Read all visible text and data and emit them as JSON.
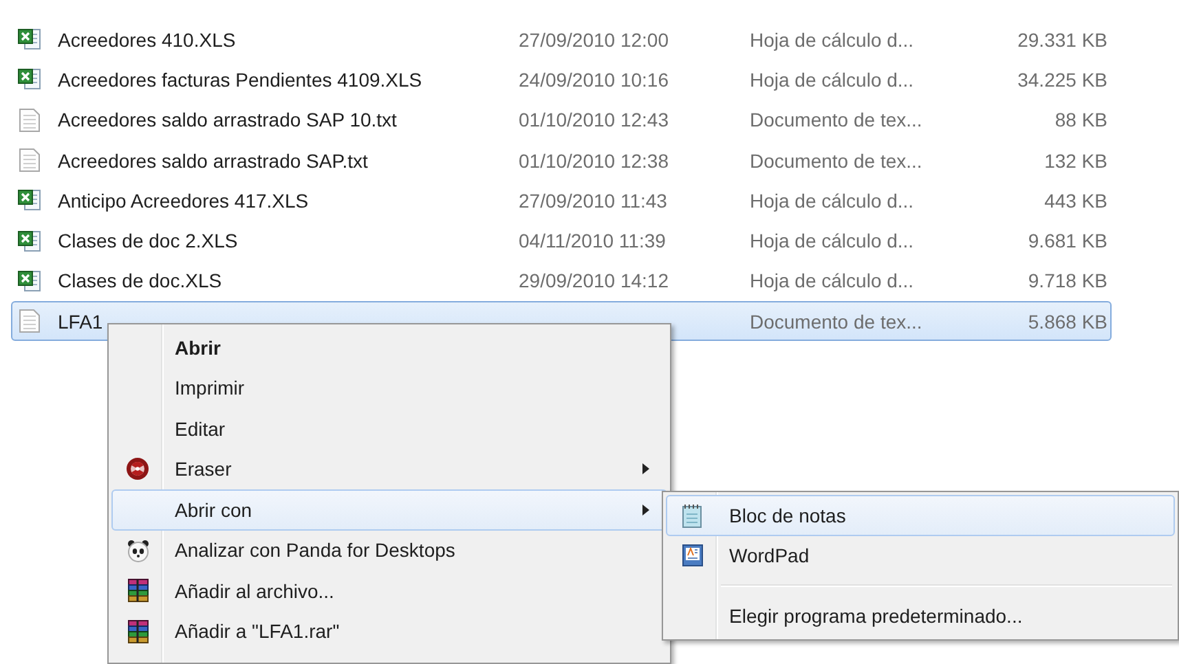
{
  "files": [
    {
      "name": "Acreedores 410.XLS",
      "modified": "27/09/2010 12:00",
      "type": "Hoja de cálculo d...",
      "size": "29.331 KB",
      "kind": "excel",
      "selected": false
    },
    {
      "name": "Acreedores facturas Pendientes 4109.XLS",
      "modified": "24/09/2010 10:16",
      "type": "Hoja de cálculo d...",
      "size": "34.225 KB",
      "kind": "excel",
      "selected": false
    },
    {
      "name": "Acreedores saldo arrastrado SAP 10.txt",
      "modified": "01/10/2010 12:43",
      "type": "Documento de tex...",
      "size": "88 KB",
      "kind": "text",
      "selected": false
    },
    {
      "name": "Acreedores saldo arrastrado SAP.txt",
      "modified": "01/10/2010 12:38",
      "type": "Documento de tex...",
      "size": "132 KB",
      "kind": "text",
      "selected": false
    },
    {
      "name": "Anticipo Acreedores 417.XLS",
      "modified": "27/09/2010 11:43",
      "type": "Hoja de cálculo d...",
      "size": "443 KB",
      "kind": "excel",
      "selected": false
    },
    {
      "name": "Clases de doc 2.XLS",
      "modified": "04/11/2010 11:39",
      "type": "Hoja de cálculo d...",
      "size": "9.681 KB",
      "kind": "excel",
      "selected": false
    },
    {
      "name": "Clases de doc.XLS",
      "modified": "29/09/2010 14:12",
      "type": "Hoja de cálculo d...",
      "size": "9.718 KB",
      "kind": "excel",
      "selected": false
    },
    {
      "name": "LFA1",
      "type": "Documento de tex...",
      "size": "5.868 KB",
      "kind": "text",
      "selected": true
    }
  ],
  "context_menu": {
    "items": [
      {
        "label": "Abrir",
        "kind": "plain",
        "default": true,
        "submenu": false,
        "selected": false
      },
      {
        "label": "Imprimir",
        "kind": "plain",
        "default": false,
        "submenu": false,
        "selected": false
      },
      {
        "label": "Editar",
        "kind": "plain",
        "default": false,
        "submenu": false,
        "selected": false
      },
      {
        "label": "Eraser",
        "kind": "eraser",
        "default": false,
        "submenu": true,
        "selected": false
      },
      {
        "label": "Abrir con",
        "kind": "plain",
        "default": false,
        "submenu": true,
        "selected": true
      },
      {
        "label": "Analizar con Panda for Desktops",
        "kind": "panda",
        "default": false,
        "submenu": false,
        "selected": false
      },
      {
        "label": "Añadir al archivo...",
        "kind": "archive",
        "default": false,
        "submenu": false,
        "selected": false
      },
      {
        "label": "Añadir a \"LFA1.rar\"",
        "kind": "archive",
        "default": false,
        "submenu": false,
        "selected": false
      }
    ]
  },
  "submenu": {
    "items": [
      {
        "label": "Bloc de notas",
        "kind": "notepad",
        "selected": true
      },
      {
        "label": "WordPad",
        "kind": "wordpad",
        "selected": false
      },
      {
        "kind": "separator"
      },
      {
        "label": "Elegir programa predeterminado...",
        "kind": "plain",
        "selected": false
      }
    ]
  }
}
